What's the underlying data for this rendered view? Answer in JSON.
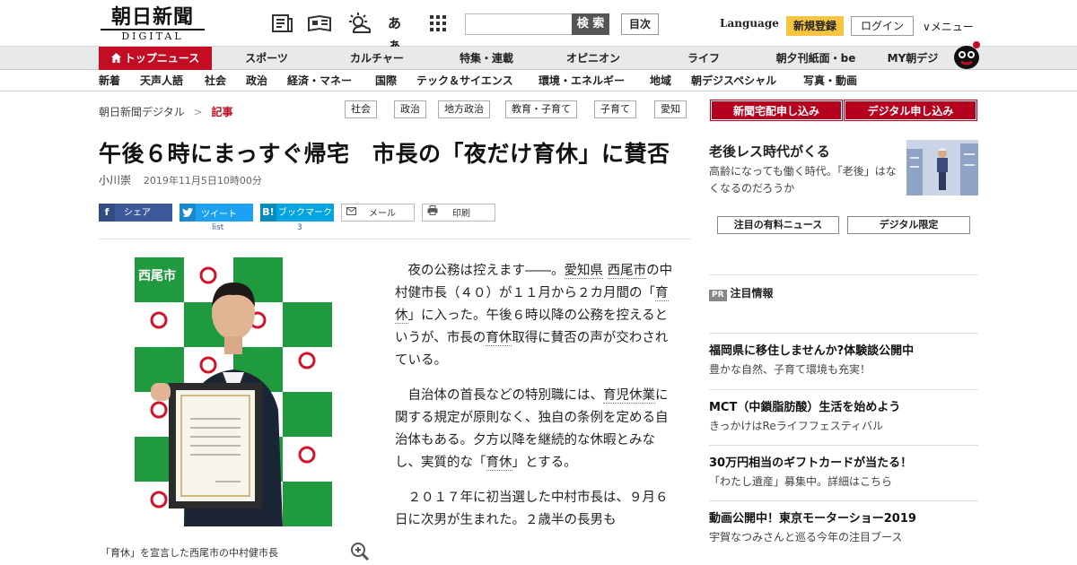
{
  "header": {
    "logo_jp": "朝日新聞",
    "logo_en": "DIGITAL",
    "icons": [
      "newspaper-icon",
      "magazine-icon",
      "weather-icon",
      "font-size-icon",
      "grid-menu-icon"
    ],
    "font_size_label": "あぁ",
    "search_placeholder": "",
    "search_label": "検 索",
    "toc_label": "目次",
    "language_label": "Language",
    "signup_label": "新規登録",
    "login_label": "ログイン",
    "menu_label": "∨メニュー"
  },
  "nav_primary": [
    "トップニュース",
    "スポーツ",
    "カルチャー",
    "特集・連載",
    "オピニオン",
    "ライフ",
    "朝夕刊紙面・be",
    "MY朝デジ"
  ],
  "nav_secondary": [
    "新着",
    "天声人語",
    "社会",
    "政治",
    "経済・マネー",
    "国際",
    "テック＆サイエンス",
    "環境・エネルギー",
    "地域",
    "朝デジスペシャル",
    "写真・動画"
  ],
  "breadcrumb": {
    "root": "朝日新聞デジタル",
    "sep": ">",
    "current": "記事"
  },
  "tags": [
    "社会",
    "政治",
    "地方政治",
    "教育・子育て",
    "子育て",
    "愛知"
  ],
  "article": {
    "headline": "午後６時にまっすぐ帰宅　市長の「夜だけ育休」に賛否",
    "author": "小川崇",
    "date": "2019年11月5日10時00分",
    "caption": "「育休」を宣言した西尾市の中村健市長",
    "photo_sign": "西尾市",
    "paragraphs": [
      [
        "夜の公務は控えます――。",
        {
          "u": "愛知県"
        },
        " ",
        {
          "u": "西尾市"
        },
        "の中村健市長（４０）が１１月から２カ月間の「",
        {
          "u": "育休"
        },
        "」に入った。午後６時以降の公務を控えるというが、市長の",
        {
          "u": "育休"
        },
        "取得に賛否の声が交わされている。"
      ],
      [
        "自治体の首長などの特別職には、",
        {
          "u": "育児休業"
        },
        "に関する規定が原則なく、独自の条例を定める自治体もある。夕方以降を継続的な休暇とみなし、実質的な「",
        {
          "u": "育休"
        },
        "」とする。"
      ],
      [
        "２０１７年に初当選した中村市長は、９月６日に次男が生まれた。２歳半の長男も"
      ]
    ]
  },
  "share": {
    "facebook": "シェア",
    "twitter": "ツイート",
    "twitter_count": "list",
    "hatena": "ブックマーク",
    "hatena_count": "3",
    "mail": "メール",
    "print": "印刷"
  },
  "sidebar": {
    "subscribe_paper": "新聞宅配申し込み",
    "subscribe_digital": "デジタル申し込み",
    "promo_title": "老後レス時代がくる",
    "promo_text": "高齢になっても働く時代。「老後」はなくなるのだろうか",
    "paid_news": "注目の有料ニュース",
    "digital_only": "デジタル限定",
    "pr_badge": "PR",
    "pr_title": "注目情報",
    "items": [
      {
        "title": "福岡県に移住しませんか?体験談公開中",
        "desc": "豊かな自然、子育て環境も充実！"
      },
      {
        "title": "MCT（中鎖脂肪酸）生活を始めよう",
        "desc": "きっかけはReライフフェスティバル"
      },
      {
        "title": "30万円相当のギフトカードが当たる！",
        "desc": "「わたし遺産」募集中。詳細はこちら"
      },
      {
        "title": "動画公開中！東京モーターショー2019",
        "desc": "宇賀なつみさんと巡る今年の注目ブース"
      }
    ]
  },
  "colors": {
    "accent": "#c30d23",
    "signup": "#f5c542",
    "facebook": "#3b5998",
    "twitter": "#1da1f2",
    "hatena": "#00a4de"
  }
}
